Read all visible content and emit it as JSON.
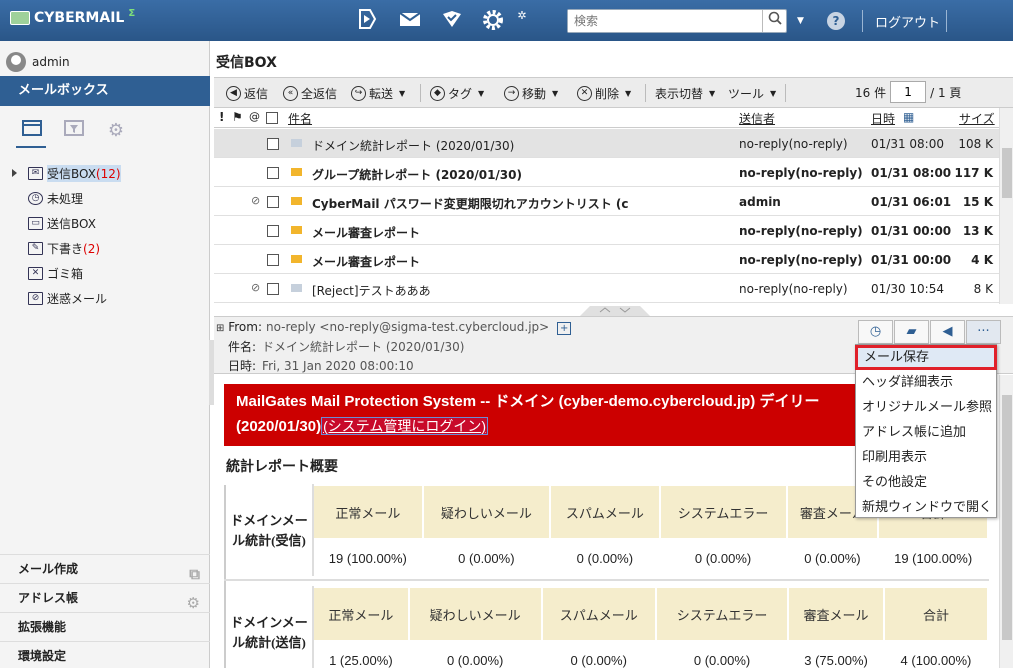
{
  "app": {
    "logo": "CYBERMAIL",
    "logo_mark": "Σ"
  },
  "top": {
    "search_placeholder": "検索",
    "logout": "ログアウト",
    "help": "?"
  },
  "sidebar": {
    "user": "admin",
    "mailbox_header": "メールボックス",
    "folders": [
      {
        "label": "受信BOX",
        "count": "(12)",
        "icon": "inbox-icon"
      },
      {
        "label": "未処理",
        "count": "",
        "icon": "clock-icon"
      },
      {
        "label": "送信BOX",
        "count": "",
        "icon": "outbox-icon"
      },
      {
        "label": "下書き",
        "count": "(2)",
        "icon": "draft-icon"
      },
      {
        "label": "ゴミ箱",
        "count": "",
        "icon": "trash-icon"
      },
      {
        "label": "迷惑メール",
        "count": "",
        "icon": "spam-icon"
      }
    ],
    "bottom": [
      "メール作成",
      "アドレス帳",
      "拡張機能",
      "環境設定"
    ]
  },
  "main": {
    "title": "受信BOX",
    "toolbar": {
      "reply": "返信",
      "reply_all": "全返信",
      "forward": "転送",
      "tag": "タグ",
      "move": "移動",
      "delete": "削除",
      "view_switch": "表示切替",
      "tools": "ツール"
    },
    "pager": {
      "count": "16 件",
      "page": "1",
      "total": "/ 1 頁"
    },
    "columns": {
      "subject": "件名",
      "sender": "送信者",
      "date": "日時",
      "size": "サイズ"
    },
    "rows": [
      {
        "subject": "ドメイン統計レポート (2020/01/30)",
        "sender": "no-reply(no-reply)",
        "date": "01/31 08:00",
        "size": "108 K",
        "bold": false,
        "read": true,
        "clip": false,
        "sel": true
      },
      {
        "subject": "グループ統計レポート (2020/01/30)",
        "sender": "no-reply(no-reply)",
        "date": "01/31 08:00",
        "size": "117 K",
        "bold": true,
        "read": false,
        "clip": false,
        "sel": false
      },
      {
        "subject": "CyberMail パスワード変更期限切れアカウントリスト (c",
        "sender": "admin",
        "date": "01/31 06:01",
        "size": "15 K",
        "bold": true,
        "read": false,
        "clip": true,
        "sel": false
      },
      {
        "subject": "メール審査レポート",
        "sender": "no-reply(no-reply)",
        "date": "01/31 00:00",
        "size": "13 K",
        "bold": true,
        "read": false,
        "clip": false,
        "sel": false
      },
      {
        "subject": "メール審査レポート",
        "sender": "no-reply(no-reply)",
        "date": "01/31 00:00",
        "size": "4 K",
        "bold": true,
        "read": false,
        "clip": false,
        "sel": false
      },
      {
        "subject": "[Reject]テストあああ",
        "sender": "no-reply(no-reply)",
        "date": "01/30 10:54",
        "size": "8 K",
        "bold": false,
        "read": true,
        "clip": true,
        "sel": false
      }
    ]
  },
  "preview": {
    "from_label": "From:",
    "from": "no-reply <no-reply@sigma-test.cybercloud.jp>",
    "subject_label": "件名:",
    "subject": "ドメイン統計レポート (2020/01/30)",
    "date_label": "日時:",
    "date": "Fri, 31 Jan 2020 08:00:10",
    "menu": [
      "メール保存",
      "ヘッダ詳細表示",
      "オリジナルメール参照",
      "アドレス帳に追加",
      "印刷用表示",
      "その他設定",
      "新規ウィンドウで開く"
    ],
    "banner_line1": "MailGates Mail Protection System -- ドメイン (cyber-demo.cybercloud.jp) デイリー",
    "banner_line2": "(2020/01/30)",
    "banner_link": "(システム管理にログイン)",
    "summary_title": "統計レポート概要",
    "table_headers": [
      "正常メール",
      "疑わしいメール",
      "スパムメール",
      "システムエラー",
      "審査メール",
      "合計"
    ],
    "table1": {
      "label": "ドメインメール統計(受信)",
      "values": [
        "19 (100.00%)",
        "0 (0.00%)",
        "0 (0.00%)",
        "0 (0.00%)",
        "0 (0.00%)",
        "19 (100.00%)"
      ]
    },
    "table2": {
      "label": "ドメインメール統計(送信)",
      "values": [
        "1 (25.00%)",
        "0 (0.00%)",
        "0 (0.00%)",
        "0 (0.00%)",
        "3 (75.00%)",
        "4 (100.00%)"
      ]
    }
  }
}
